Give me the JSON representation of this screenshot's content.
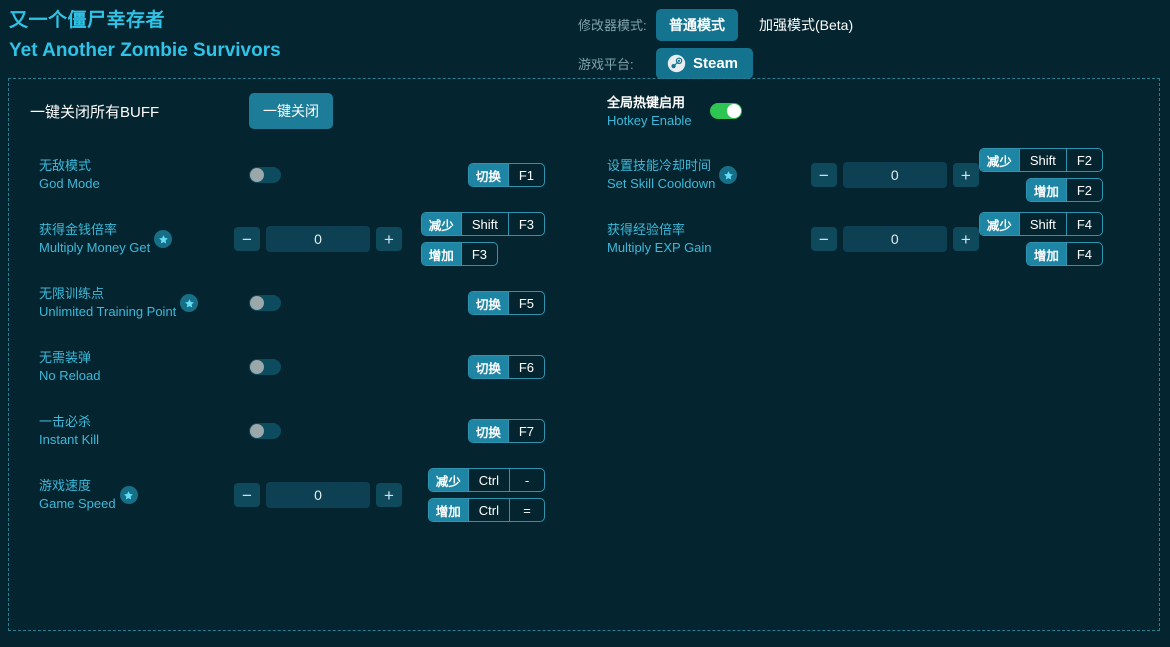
{
  "header": {
    "title_cn": "又一个僵尸幸存者",
    "title_en": "Yet Another Zombie Survivors",
    "mode_label": "修改器模式:",
    "mode_normal": "普通模式",
    "mode_enhanced": "加强模式(Beta)",
    "platform_label": "游戏平台:",
    "platform_value": "Steam",
    "accent": "#2fc3e8",
    "active_tab_bg": "#14748f"
  },
  "left": {
    "buff_label": "一键关闭所有BUFF",
    "buff_button": "一键关闭",
    "rows": [
      {
        "name_cn": "无敌模式",
        "name_en": "God Mode",
        "star": false,
        "control": "toggle",
        "toggle_on": false,
        "hotkeys": [
          {
            "action": "切换",
            "keys": [
              "F1"
            ]
          }
        ]
      },
      {
        "name_cn": "获得金钱倍率",
        "name_en": "Multiply Money Get",
        "star": true,
        "control": "stepper",
        "value": "0",
        "hotkeys": [
          {
            "action": "减少",
            "keys": [
              "Shift",
              "F3"
            ]
          },
          {
            "action": "增加",
            "keys": [
              "F3"
            ]
          }
        ]
      },
      {
        "name_cn": "无限训练点",
        "name_en": "Unlimited Training Point",
        "star": true,
        "control": "toggle",
        "toggle_on": false,
        "hotkeys": [
          {
            "action": "切换",
            "keys": [
              "F5"
            ]
          }
        ]
      },
      {
        "name_cn": "无需装弹",
        "name_en": "No Reload",
        "star": false,
        "control": "toggle",
        "toggle_on": false,
        "hotkeys": [
          {
            "action": "切换",
            "keys": [
              "F6"
            ]
          }
        ]
      },
      {
        "name_cn": "一击必杀",
        "name_en": "Instant Kill",
        "star": false,
        "control": "toggle",
        "toggle_on": false,
        "hotkeys": [
          {
            "action": "切换",
            "keys": [
              "F7"
            ]
          }
        ]
      },
      {
        "name_cn": "游戏速度",
        "name_en": "Game Speed",
        "star": true,
        "control": "stepper",
        "value": "0",
        "hotkeys": [
          {
            "action": "减少",
            "keys": [
              "Ctrl",
              "-"
            ]
          },
          {
            "action": "增加",
            "keys": [
              "Ctrl",
              "="
            ]
          }
        ]
      }
    ]
  },
  "right": {
    "global_cn": "全局热键启用",
    "global_en": "Hotkey Enable",
    "global_on": true,
    "global_on_color": "#2fc552",
    "rows": [
      {
        "name_cn": "设置技能冷却时间",
        "name_en": "Set Skill Cooldown",
        "star": true,
        "control": "stepper",
        "value": "0",
        "hotkeys": [
          {
            "action": "减少",
            "keys": [
              "Shift",
              "F2"
            ]
          },
          {
            "action": "增加",
            "keys": [
              "F2"
            ]
          }
        ]
      },
      {
        "name_cn": "获得经验倍率",
        "name_en": "Multiply EXP Gain",
        "star": false,
        "control": "stepper",
        "value": "0",
        "hotkeys": [
          {
            "action": "减少",
            "keys": [
              "Shift",
              "F4"
            ]
          },
          {
            "action": "增加",
            "keys": [
              "F4"
            ]
          }
        ]
      }
    ]
  }
}
